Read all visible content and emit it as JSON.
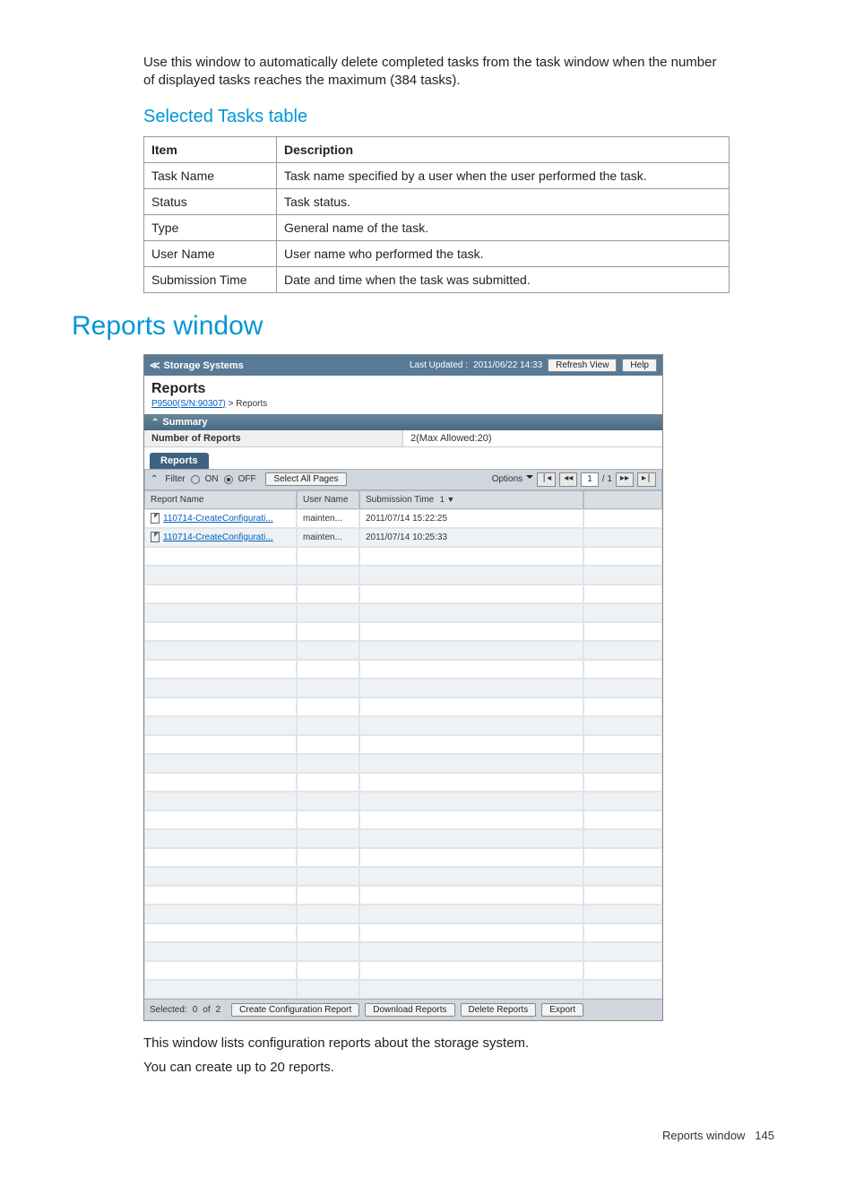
{
  "intro": "Use this window to automatically delete completed tasks from the task window when the number of displayed tasks reaches the maximum (384 tasks).",
  "selected_tasks_heading": "Selected Tasks table",
  "table_headers": {
    "item": "Item",
    "desc": "Description"
  },
  "table_rows": [
    {
      "item": "Task Name",
      "desc": "Task name specified by a user when the user performed the task."
    },
    {
      "item": "Status",
      "desc": "Task status."
    },
    {
      "item": "Type",
      "desc": "General name of the task."
    },
    {
      "item": "User Name",
      "desc": "User name who performed the task."
    },
    {
      "item": "Submission Time",
      "desc": "Date and time when the task was submitted."
    }
  ],
  "reports_heading": "Reports window",
  "screenshot": {
    "topbar": {
      "title": "Storage Systems",
      "last_updated_label": "Last Updated :",
      "last_updated_value": "2011/06/22 14:33",
      "refresh": "Refresh View",
      "help": "Help"
    },
    "page_title": "Reports",
    "breadcrumb_link": "P9500(S/N:90307)",
    "breadcrumb_sep": ">",
    "breadcrumb_current": "Reports",
    "summary": {
      "label": "Summary",
      "row1_key": "Number of Reports",
      "row1_val": "2(Max Allowed:20)"
    },
    "tab": "Reports",
    "toolbar": {
      "filter_label": "Filter",
      "on": "ON",
      "off": "OFF",
      "select_all": "Select All Pages",
      "options": "Options",
      "page_current": "1",
      "page_total": "/ 1"
    },
    "columns": {
      "report_name": "Report Name",
      "user_name": "User Name",
      "submission_time": "Submission Time",
      "sort_indicator": "1 ▼"
    },
    "rows": [
      {
        "name": "110714-CreateConfigurati...",
        "user": "mainten...",
        "sub": "2011/07/14 15:22:25"
      },
      {
        "name": "110714-CreateConfigurati...",
        "user": "mainten...",
        "sub": "2011/07/14 10:25:33"
      }
    ],
    "bottom": {
      "selected_label": "Selected:",
      "selected_n": "0",
      "of_label": "of",
      "total_n": "2",
      "create": "Create Configuration Report",
      "download": "Download Reports",
      "delete": "Delete Reports",
      "export": "Export"
    }
  },
  "desc1": "This window lists configuration reports about the storage system.",
  "desc2": "You can create up to 20 reports.",
  "page_footer_label": "Reports window",
  "page_number": "145",
  "chart_data": {
    "type": "table",
    "title": "Selected Tasks table",
    "columns": [
      "Item",
      "Description"
    ],
    "rows": [
      [
        "Task Name",
        "Task name specified by a user when the user performed the task."
      ],
      [
        "Status",
        "Task status."
      ],
      [
        "Type",
        "General name of the task."
      ],
      [
        "User Name",
        "User name who performed the task."
      ],
      [
        "Submission Time",
        "Date and time when the task was submitted."
      ]
    ]
  }
}
